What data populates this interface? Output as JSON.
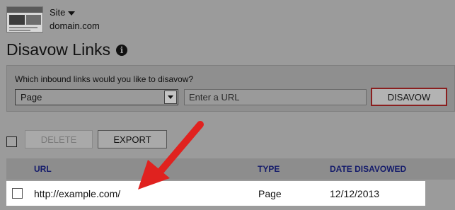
{
  "header": {
    "site_label": "Site",
    "domain": "domain.com",
    "title": "Disavow Links"
  },
  "disavow_form": {
    "prompt": "Which inbound links would you like to disavow?",
    "type_selected": "Page",
    "url_placeholder": "Enter a URL",
    "submit_label": "DISAVOW"
  },
  "toolbar": {
    "delete_label": "DELETE",
    "export_label": "EXPORT"
  },
  "table": {
    "columns": [
      "URL",
      "TYPE",
      "DATE DISAVOWED"
    ],
    "rows": [
      {
        "url": "http://example.com/",
        "type": "Page",
        "date": "12/12/2013"
      }
    ]
  },
  "colors": {
    "overlay_gray": "#9b9b9b",
    "header_link_blue": "#141b6b",
    "disavow_border": "#8a1f1f",
    "arrow_red": "#e0221f"
  },
  "icons": {
    "info": "info-icon",
    "caret": "chevron-down-icon",
    "annotation": "red-arrow"
  }
}
